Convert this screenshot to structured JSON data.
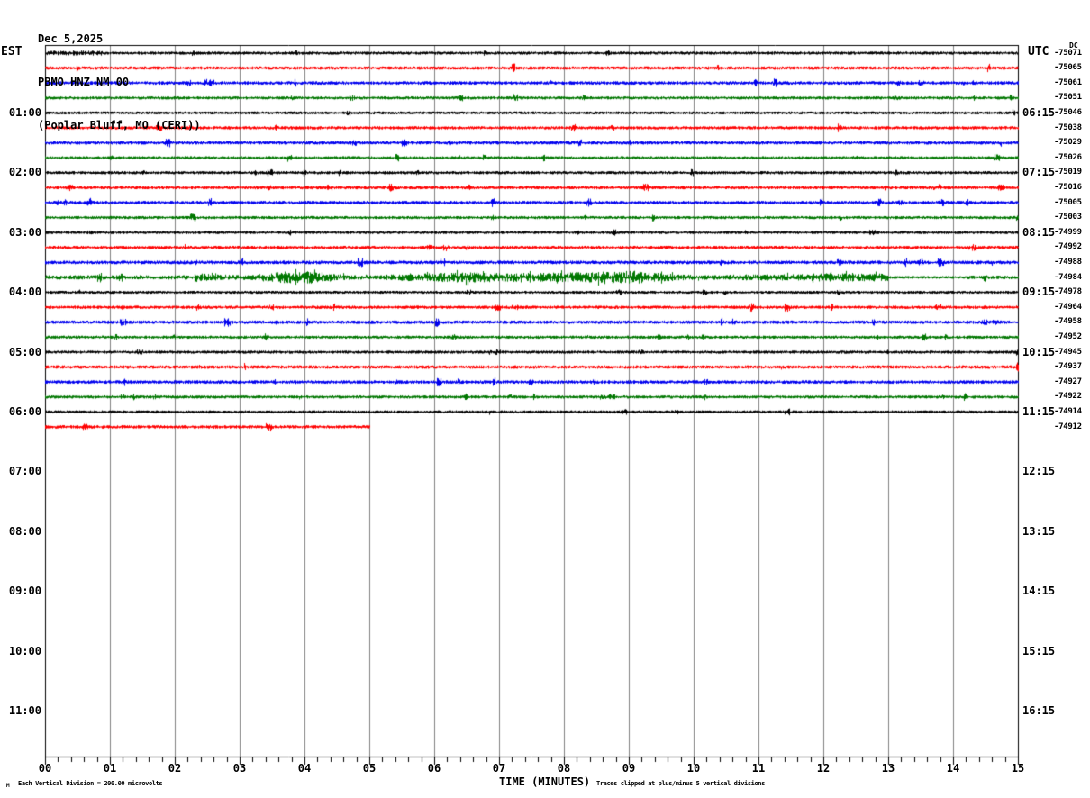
{
  "header": {
    "date": "Dec 5,2025",
    "station": "PBMO HNZ NM 00",
    "location": "(Poplar Bluff, MO (CERI))"
  },
  "axis": {
    "left_timezone": "EST",
    "right_timezone": "UTC",
    "dc_label": "DC",
    "x_title": "TIME (MINUTES)",
    "x_tick_labels": [
      "00",
      "01",
      "02",
      "03",
      "04",
      "05",
      "06",
      "07",
      "08",
      "09",
      "10",
      "11",
      "12",
      "13",
      "14",
      "15"
    ],
    "left_hour_labels": [
      {
        "text": "01:00",
        "row": 4
      },
      {
        "text": "02:00",
        "row": 8
      },
      {
        "text": "03:00",
        "row": 12
      },
      {
        "text": "04:00",
        "row": 16
      },
      {
        "text": "05:00",
        "row": 20
      },
      {
        "text": "06:00",
        "row": 24
      },
      {
        "text": "07:00",
        "row": 28
      },
      {
        "text": "08:00",
        "row": 32
      },
      {
        "text": "09:00",
        "row": 36
      },
      {
        "text": "10:00",
        "row": 40
      },
      {
        "text": "11:00",
        "row": 44
      }
    ],
    "right_hour_labels": [
      {
        "text": "06:15",
        "row": 4
      },
      {
        "text": "07:15",
        "row": 8
      },
      {
        "text": "08:15",
        "row": 12
      },
      {
        "text": "09:15",
        "row": 16
      },
      {
        "text": "10:15",
        "row": 20
      },
      {
        "text": "11:15",
        "row": 24
      },
      {
        "text": "12:15",
        "row": 28
      },
      {
        "text": "13:15",
        "row": 32
      },
      {
        "text": "14:15",
        "row": 36
      },
      {
        "text": "15:15",
        "row": 40
      },
      {
        "text": "16:15",
        "row": 44
      }
    ]
  },
  "footer": {
    "scale_note": "Each Vertical Division =  200.00 microvolts",
    "clip_note": "Traces clipped at plus/minus 5 vertical divisions",
    "corner_mark": "M"
  },
  "chart_data": {
    "type": "line",
    "description": "Helicorder/webicorder seismogram: each row is one 15-minute seismic trace, colors cycle black-red-blue-green, hour marks every 4 rows",
    "x_axis": {
      "label": "TIME (MINUTES)",
      "min": 0,
      "max": 15,
      "gridline_every_minutes": 1,
      "minor_ticks_per_minute": 5
    },
    "grid": "on",
    "trace_color_cycle": [
      "black",
      "red",
      "blue",
      "green"
    ],
    "palette": {
      "black": "#000000",
      "red": "#ff0000",
      "blue": "#0000ee",
      "green": "#007700",
      "grid": "#808080"
    },
    "rows": [
      {
        "color": "black",
        "right_value": "-75071",
        "start": 0,
        "end": 15,
        "amp": 1.3,
        "segments": [
          {
            "from": 0,
            "to": 0.9,
            "amp": 2.3
          },
          {
            "from": 0.9,
            "to": 15,
            "amp": 1.3
          }
        ]
      },
      {
        "color": "red",
        "right_value": "-75065",
        "start": 0,
        "end": 15,
        "amp": 1.4
      },
      {
        "color": "blue",
        "right_value": "-75061",
        "start": 0,
        "end": 15,
        "amp": 1.5
      },
      {
        "color": "green",
        "right_value": "-75051",
        "start": 0,
        "end": 15,
        "amp": 1.3
      },
      {
        "color": "black",
        "right_value": "-75046",
        "est": "01:00",
        "utc": "06:15",
        "start": 0,
        "end": 15,
        "amp": 1.2
      },
      {
        "color": "red",
        "right_value": "-75038",
        "start": 0,
        "end": 15,
        "amp": 1.4
      },
      {
        "color": "blue",
        "right_value": "-75029",
        "start": 0,
        "end": 15,
        "amp": 1.5
      },
      {
        "color": "green",
        "right_value": "-75026",
        "start": 0,
        "end": 15,
        "amp": 1.3
      },
      {
        "color": "black",
        "right_value": "-75019",
        "est": "02:00",
        "utc": "07:15",
        "start": 0,
        "end": 15,
        "amp": 1.3
      },
      {
        "color": "red",
        "right_value": "-75016",
        "start": 0,
        "end": 15,
        "amp": 1.4
      },
      {
        "color": "blue",
        "right_value": "-75005",
        "start": 0,
        "end": 15,
        "amp": 1.5
      },
      {
        "color": "green",
        "right_value": "-75003",
        "start": 0,
        "end": 15,
        "amp": 1.3
      },
      {
        "color": "black",
        "right_value": "-74999",
        "est": "03:00",
        "utc": "08:15",
        "start": 0,
        "end": 15,
        "amp": 1.2
      },
      {
        "color": "red",
        "right_value": "-74992",
        "start": 0,
        "end": 15,
        "amp": 1.4
      },
      {
        "color": "blue",
        "right_value": "-74988",
        "start": 0,
        "end": 15,
        "amp": 1.6
      },
      {
        "color": "green",
        "right_value": "-74984",
        "start": 0,
        "end": 15,
        "amp": 1.8,
        "segments": [
          {
            "from": 0,
            "to": 2.3,
            "amp": 2.0
          },
          {
            "from": 2.3,
            "to": 13.0,
            "amp": 5.2,
            "bursty": true
          },
          {
            "from": 13.0,
            "to": 14.2,
            "amp": 1.1
          },
          {
            "from": 14.2,
            "to": 15,
            "amp": 1.6
          }
        ]
      },
      {
        "color": "black",
        "right_value": "-74978",
        "est": "04:00",
        "utc": "09:15",
        "start": 0,
        "end": 15,
        "amp": 1.2
      },
      {
        "color": "red",
        "right_value": "-74964",
        "start": 0,
        "end": 15,
        "amp": 1.4
      },
      {
        "color": "blue",
        "right_value": "-74958",
        "start": 0,
        "end": 15,
        "amp": 1.5
      },
      {
        "color": "green",
        "right_value": "-74952",
        "start": 0,
        "end": 15,
        "amp": 1.3
      },
      {
        "color": "black",
        "right_value": "-74945",
        "est": "05:00",
        "utc": "10:15",
        "start": 0,
        "end": 15,
        "amp": 1.3
      },
      {
        "color": "red",
        "right_value": "-74937",
        "start": 0,
        "end": 15,
        "amp": 1.5
      },
      {
        "color": "blue",
        "right_value": "-74927",
        "start": 0,
        "end": 15,
        "amp": 1.5
      },
      {
        "color": "green",
        "right_value": "-74922",
        "start": 0,
        "end": 15,
        "amp": 1.3
      },
      {
        "color": "black",
        "right_value": "-74914",
        "est": "06:00",
        "utc": "11:15",
        "start": 0,
        "end": 15,
        "amp": 1.3
      },
      {
        "color": "red",
        "right_value": "-74912",
        "start": 0,
        "end": 5,
        "amp": 1.5
      }
    ]
  }
}
